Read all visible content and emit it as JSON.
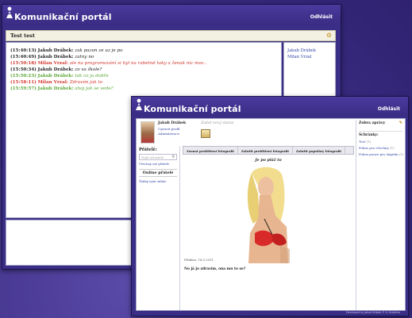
{
  "app_title": "Komunikační portál",
  "logout_label": "Odhlásit",
  "chat": {
    "room_name": "Test test",
    "messages": [
      {
        "time": "(15:40:13)",
        "name": "Jakub Drábek:",
        "text": "zak pazon ze uz je po",
        "color": "black"
      },
      {
        "time": "(15:40:49)",
        "name": "Jakub Drábek:",
        "text": "zatny no",
        "color": "black"
      },
      {
        "time": "(15:50:18)",
        "name": "Milan Vrzal:",
        "text": "ale na programování si byl na rabetně taky a ženak nic moc..",
        "color": "red"
      },
      {
        "time": "(15:50:34)",
        "name": "Jakub Drábek:",
        "text": "zo va škole?",
        "color": "black"
      },
      {
        "time": "(15:50:23)",
        "name": "Jakub Drábek:",
        "text": "tak co ja dobře",
        "color": "green"
      },
      {
        "time": "(15:58:11)",
        "name": "Milan Vrzal:",
        "text": "Zdravím jak to",
        "color": "red"
      },
      {
        "time": "(15:59:57)",
        "name": "Jakub Drábek:",
        "text": "ahoj jak se vede?",
        "color": "green"
      }
    ],
    "users": [
      "Jakub Drábek",
      "Milan Vrzal"
    ]
  },
  "blog": {
    "profile": {
      "name": "Jakub Drábek",
      "links": [
        "Upravit profil",
        "Administrace"
      ]
    },
    "status_placeholder": "Zadat nový status",
    "sidebar": {
      "friends_heading": "Přátelé:",
      "search_placeholder": "Najít uživatele",
      "all_friends_link": "Všechny mé přátele",
      "online_heading": "Online přátelé",
      "online_empty": "Žádný nyní online"
    },
    "tabs": [
      "Zasnat prohlížení fotografii",
      "Založit prohlížení fotografii",
      "Založit populáry fotografii"
    ],
    "post": {
      "title": "Je po pláž to",
      "date": "Přidáno: 14.3.2011",
      "text": "No já jo zdravím, ona mu to se?"
    },
    "messages_panel": {
      "heading": "Zobra zprávy",
      "subheading": "Schránky:",
      "items": [
        {
          "label": "Test",
          "count": "(1)"
        },
        {
          "label": "Pokus pro všechny",
          "count": "(1)"
        },
        {
          "label": "Pokus pouze pro šiaptím",
          "count": "(1)"
        }
      ]
    },
    "footer": "Developed by Jakub Drábek © G. Krzdelna"
  }
}
